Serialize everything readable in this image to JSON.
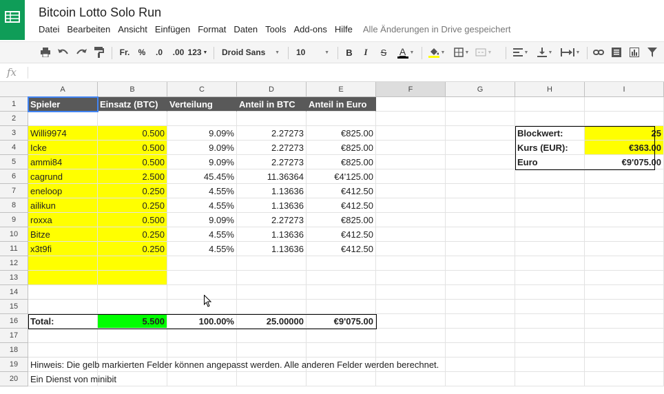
{
  "app": {
    "title": "Bitcoin Lotto Solo Run",
    "save_status": "Alle Änderungen in Drive gespeichert",
    "menu": [
      "Datei",
      "Bearbeiten",
      "Ansicht",
      "Einfügen",
      "Format",
      "Daten",
      "Tools",
      "Add-ons",
      "Hilfe"
    ]
  },
  "toolbar": {
    "currency": "Fr.",
    "percent": "%",
    "dec_decrease": ".0",
    "dec_increase": ".00",
    "more_formats": "123",
    "font": "Droid Sans",
    "font_size": "10",
    "bold": "B",
    "italic": "I",
    "strike": "S",
    "text_color": "A",
    "text_color_value": "#000000",
    "fill_color_value": "#ffff00"
  },
  "formula_bar": {
    "label": "fx",
    "value": ""
  },
  "columns": [
    "A",
    "B",
    "C",
    "D",
    "E",
    "F",
    "G",
    "H",
    "I"
  ],
  "rows": [
    "1",
    "2",
    "3",
    "4",
    "5",
    "6",
    "7",
    "8",
    "9",
    "10",
    "11",
    "12",
    "13",
    "14",
    "15",
    "16",
    "17",
    "18",
    "19",
    "20"
  ],
  "headers": [
    "Spieler",
    "Einsatz (BTC)",
    "Verteilung",
    "Anteil in BTC",
    "Anteil in Euro"
  ],
  "players": [
    {
      "name": "Willi9974",
      "einsatz": "0.500",
      "verteilung": "9.09%",
      "btc": "2.27273",
      "euro": "€825.00"
    },
    {
      "name": "Icke",
      "einsatz": "0.500",
      "verteilung": "9.09%",
      "btc": "2.27273",
      "euro": "€825.00"
    },
    {
      "name": "ammi84",
      "einsatz": "0.500",
      "verteilung": "9.09%",
      "btc": "2.27273",
      "euro": "€825.00"
    },
    {
      "name": "cagrund",
      "einsatz": "2.500",
      "verteilung": "45.45%",
      "btc": "11.36364",
      "euro": "€4'125.00"
    },
    {
      "name": "eneloop",
      "einsatz": "0.250",
      "verteilung": "4.55%",
      "btc": "1.13636",
      "euro": "€412.50"
    },
    {
      "name": "ailikun",
      "einsatz": "0.250",
      "verteilung": "4.55%",
      "btc": "1.13636",
      "euro": "€412.50"
    },
    {
      "name": "roxxa",
      "einsatz": "0.500",
      "verteilung": "9.09%",
      "btc": "2.27273",
      "euro": "€825.00"
    },
    {
      "name": "Bitze",
      "einsatz": "0.250",
      "verteilung": "4.55%",
      "btc": "1.13636",
      "euro": "€412.50"
    },
    {
      "name": "x3t9fi",
      "einsatz": "0.250",
      "verteilung": "4.55%",
      "btc": "1.13636",
      "euro": "€412.50"
    }
  ],
  "total": {
    "label": "Total:",
    "einsatz": "5.500",
    "verteilung": "100.00%",
    "btc": "25.00000",
    "euro": "€9'075.00"
  },
  "side": [
    {
      "label": "Blockwert:",
      "value": "25"
    },
    {
      "label": "Kurs (EUR):",
      "value": "€363.00"
    },
    {
      "label": "Euro",
      "value": "€9'075.00"
    }
  ],
  "notes": [
    "Hinweis: Die gelb markierten Felder können angepasst werden. Alle anderen Felder werden berechnet.",
    "Ein Dienst von minibit"
  ],
  "colors": {
    "yellow": "#ffff00",
    "green": "#00ff00",
    "header_dark": "#595959",
    "sheets_green": "#0f9d58"
  }
}
